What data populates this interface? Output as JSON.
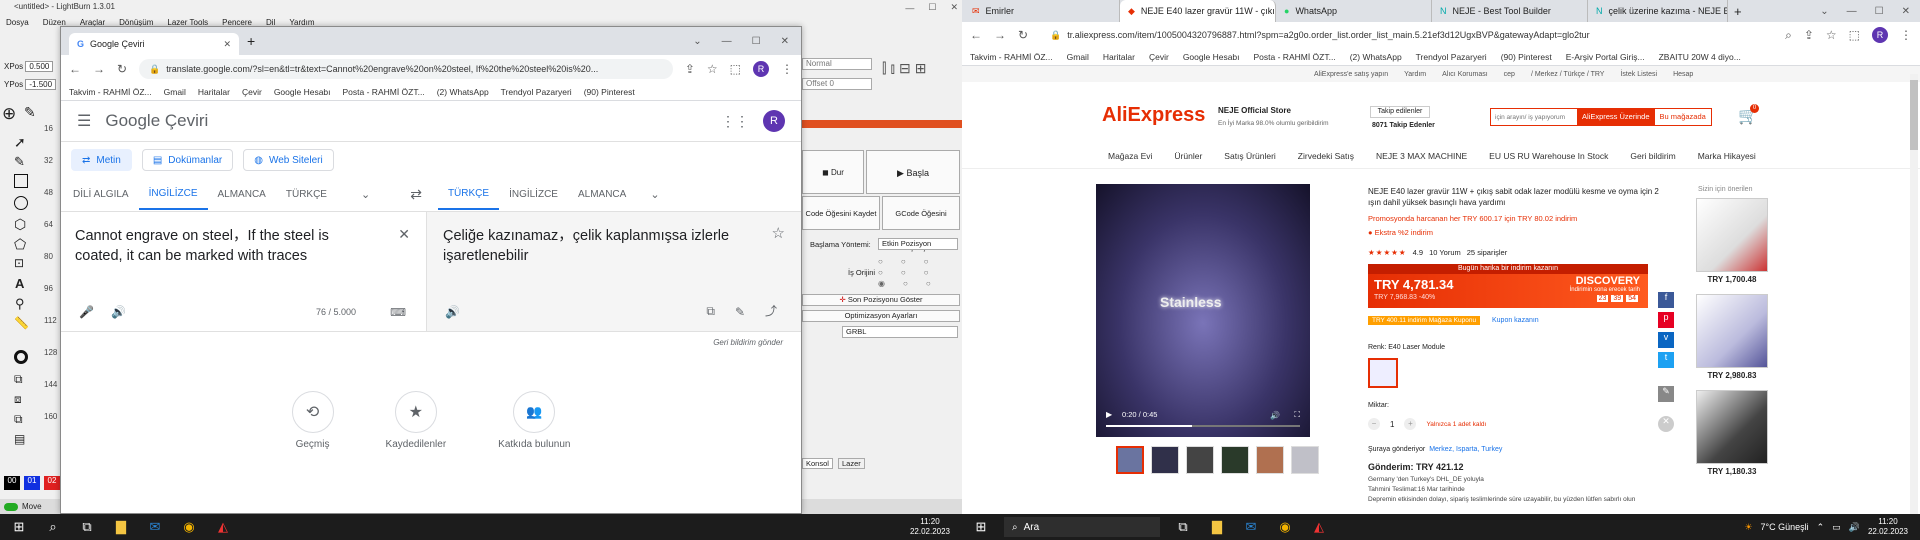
{
  "lightburn": {
    "title": "<untitled> - LightBurn 1.3.01",
    "menu": [
      "Dosya",
      "Düzen",
      "Araçlar",
      "Dönüşüm",
      "Lazer Tools",
      "Pencere",
      "Dil",
      "Yardım"
    ],
    "xpos_label": "XPos",
    "xpos_value": "0.500",
    "ypos_label": "YPos",
    "ypos_value": "-1.500",
    "ruler": [
      "16",
      "32",
      "48",
      "64",
      "80",
      "96",
      "112",
      "128",
      "144",
      "160",
      "176"
    ],
    "font_normal": "Normal",
    "offset": "Offset",
    "offset_value": "0",
    "btn_stop": "Dur",
    "btn_start": "Başla",
    "btn_gcode_save": "Code Öğesini Kaydet",
    "btn_gcode_run": "GCode Öğesini Çalıştır",
    "start_method_label": "Başlama Yöntemi:",
    "start_method_value": "Etkin Pozisyon",
    "origin_label": "İş Orijini",
    "btn_last_pos": "Son Pozisyonu Göster",
    "btn_opt": "Optimizasyon Ayarları",
    "device": "GRBL",
    "tab_console": "Konsol",
    "tab_laser": "Lazer",
    "status_move": "Move",
    "colors": [
      "00",
      "01",
      "02"
    ]
  },
  "translate": {
    "tab_title": "Google Çeviri",
    "url": "translate.google.com/?sl=en&tl=tr&text=Cannot%20engrave%20on%20steel,  If%20the%20steel%20is%20...",
    "bookmarks": [
      "Takvim - RAHMİ ÖZ...",
      "Gmail",
      "Haritalar",
      "Çevir",
      "Google Hesabı",
      "Posta - RAHMİ ÖZT...",
      "(2) WhatsApp",
      "Trendyol Pazaryeri",
      "(90) Pinterest"
    ],
    "logo": "Google Çeviri",
    "avatar": "R",
    "chips": [
      "Metin",
      "Dokümanlar",
      "Web Siteleri"
    ],
    "src_langs": [
      "DİLİ ALGILA",
      "İNGİLİZCE",
      "ALMANCA",
      "TÜRKÇE"
    ],
    "tgt_langs": [
      "TÜRKÇE",
      "İNGİLİZCE",
      "ALMANCA"
    ],
    "source_text": "Cannot engrave on steel，If the steel is coated, it can be marked with traces",
    "target_text": "Çeliğe kazınamaz，çelik kaplanmışsa izlerle işaretlenebilir",
    "char_count": "76 / 5.000",
    "feedback": "Geri bildirim gönder",
    "bottom": [
      {
        "icon": "history-icon",
        "label": "Geçmiş",
        "glyph": "⟲"
      },
      {
        "icon": "star-icon",
        "label": "Kaydedilenler",
        "glyph": "★"
      },
      {
        "icon": "people-icon",
        "label": "Katkıda bulunun",
        "glyph": "👥"
      }
    ]
  },
  "taskbar_left": {
    "time": "11:20",
    "date": "22.02.2023"
  },
  "aliexpress": {
    "tabs": [
      {
        "label": "Emirler",
        "active": false
      },
      {
        "label": "NEJE E40 lazer gravür 11W - çıkış",
        "active": true
      },
      {
        "label": "WhatsApp",
        "active": false
      },
      {
        "label": "NEJE - Best Tool Builder",
        "active": false
      },
      {
        "label": "çelik üzerine kazıma - NEJE E40",
        "active": false
      }
    ],
    "url": "tr.aliexpress.com/item/1005004320796887.html?spm=a2g0o.order_list.order_list_main.5.21ef3d12UgxBVP&gatewayAdapt=glo2tur",
    "bookmarks": [
      "Takvim - RAHMİ ÖZ...",
      "Gmail",
      "Haritalar",
      "Çevir",
      "Google Hesabı",
      "Posta - RAHMİ ÖZT...",
      "(2) WhatsApp",
      "Trendyol Pazaryeri",
      "(90) Pinterest",
      "E-Arşiv Portal Giriş...",
      "ZBAITU 20W 4 diyo..."
    ],
    "topbar": [
      "AliExpress'e satış yapın",
      "Yardım",
      "Alıcı Koruması",
      "cep",
      "/ Merkez / Türkçe / TRY",
      "İstek Listesi",
      "Hesap"
    ],
    "logo": "AliExpress",
    "store_name": "NEJE Official Store",
    "store_sub": "En İyi Marka  98.0% olumlu geribildirim",
    "follow_btn": "Takip edilenler",
    "followers": "8071 Takip Edenler",
    "search_placeholder": "için arayın/ iş yapıyorum",
    "btn_search_ae": "AliExpress Üzerinde",
    "btn_search_store": "Bu mağazada",
    "cart_count": "0",
    "nav": [
      "Mağaza Evi",
      "Ürünler",
      "Satış Ürünleri",
      "Zirvedeki Satış",
      "NEJE 3 MAX MACHINE",
      "EU US RU Warehouse In Stock",
      "Geri bildirim",
      "Marka Hikayesi"
    ],
    "video_time": "0:20 / 0:45",
    "video_overlay": "Stainless",
    "product_title": "NEJE E40 lazer gravür 11W + çıkış sabit odak lazer modülü kesme ve oyma için 2 ışın dahil yüksek basınçlı hava yardımı",
    "promo": "Promosyonda harcanan her TRY 600.17 için TRY 80.02 indirim",
    "extra": "Ekstra %2 indirim",
    "rating": "4.9",
    "reviews": "10 Yorum",
    "orders": "25 siparişler",
    "deal_banner": "Bugün harika bir indirim kazanın",
    "price": "TRY 4,781.34",
    "old_price": "TRY 7,968.83  -40%",
    "discovery": "DISCOVERY",
    "discovery_sub": "İndirimin sona erecek tarih",
    "countdown": [
      "23",
      "39",
      "54"
    ],
    "coupon": "TRY 400.11 indirim Mağaza Kuponu",
    "coupon_link": "Kupon kazanın",
    "color_label": "Renk: E40 Laser Module",
    "qty_label": "Miktar:",
    "qty": "1",
    "qty_note": "Yalnızca 1 adet kaldı",
    "ship_to": "Şuraya gönderiyor",
    "ship_loc": "Merkez, Isparta, Turkey",
    "shipping": "Gönderim: TRY 421.12",
    "ship_from": "Germany 'den Turkey's DHL_DE yoluyla",
    "delivery": "Tahmini Teslimat:16 Mar tarihinde",
    "notice": "Depremin etkisinden dolayı, sipariş teslimlerinde süre uzayabilir, bu yüzden lütfen sabırlı olun",
    "side_title": "Sizin için önerilen",
    "side_items": [
      {
        "price": "TRY 1,700.48"
      },
      {
        "price": "TRY 2,980.83"
      },
      {
        "price": "TRY 1,180.33"
      }
    ]
  },
  "taskbar_right": {
    "search": "Ara",
    "weather": "7°C  Güneşli",
    "time": "11:20",
    "date": "22.02.2023"
  }
}
